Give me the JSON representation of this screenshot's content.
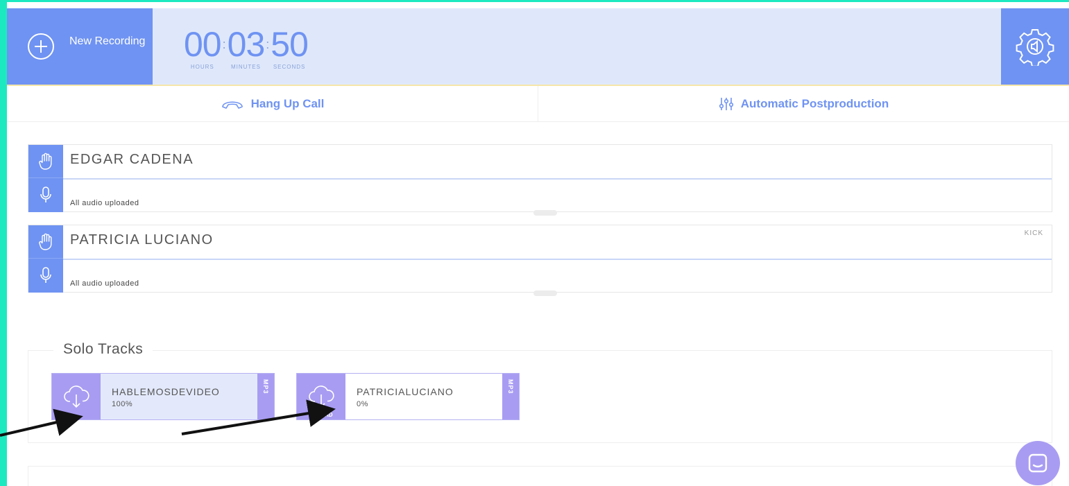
{
  "header": {
    "new_recording_label": "New Recording",
    "timer": {
      "hours": "00",
      "minutes": "03",
      "seconds": "50",
      "hours_label": "HOURS",
      "minutes_label": "MINUTES",
      "seconds_label": "SECONDS"
    },
    "settings_icon": "gear-icon"
  },
  "actions": {
    "hang_up_label": "Hang Up Call",
    "postproduction_label": "Automatic Postproduction"
  },
  "participants": [
    {
      "name": "EDGAR CADENA",
      "status": "All audio uploaded",
      "kick_label": ""
    },
    {
      "name": "PATRICIA LUCIANO",
      "status": "All audio uploaded",
      "kick_label": "KICK"
    }
  ],
  "solo_tracks": {
    "title": "Solo Tracks",
    "tracks": [
      {
        "name": "HABLEMOSDEVIDEO",
        "progress": "100%",
        "format": "MP3",
        "download_label": ""
      },
      {
        "name": "PATRICIALUCIANO",
        "progress": "0%",
        "format": "MP3",
        "download_label": "AD"
      }
    ]
  },
  "colors": {
    "accent": "#6f93f2",
    "track_accent": "#a89cf2",
    "frame": "#1de9c0"
  }
}
